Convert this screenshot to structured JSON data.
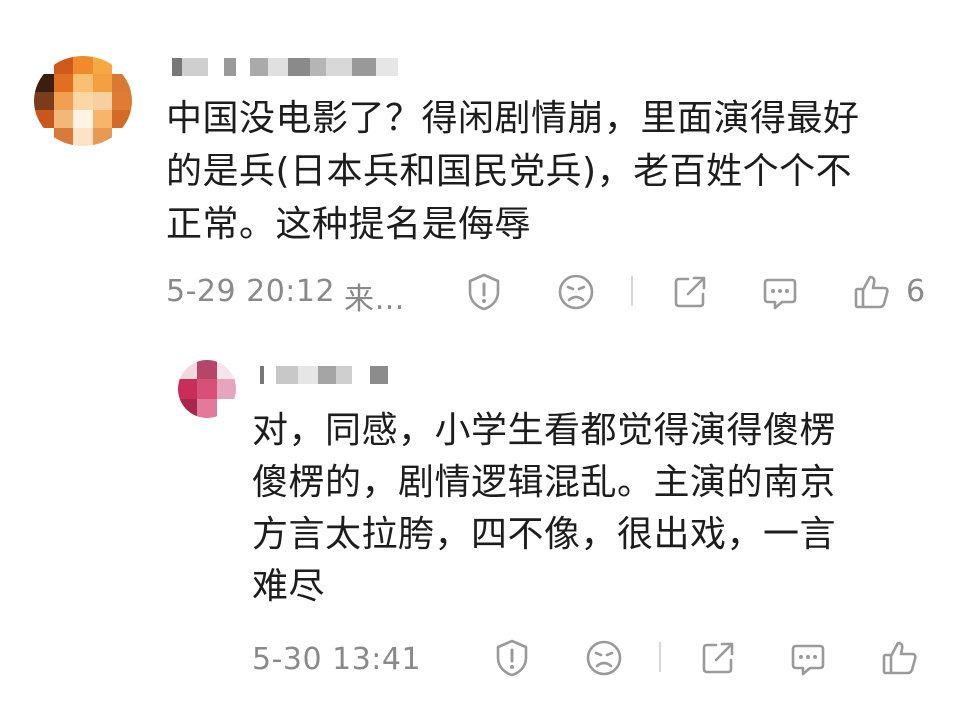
{
  "comments": [
    {
      "content": "中国没电影了？得闲剧情崩，里面演得最好的是兵(日本兵和国民党兵)，老百姓个个不正常。这种提名是侮辱",
      "lines": [
        "中国没电影了？得闲剧情崩，里面演得最好",
        "的是兵(日本兵和国民党兵)，老百姓个个不",
        "正常。这种提名是侮辱"
      ],
      "timestamp": "5-29 20:12",
      "source": "来…",
      "like_count": "6"
    },
    {
      "content": "对，同感，小学生看都觉得演得傻楞傻楞的，剧情逻辑混乱。主演的南京方言太拉胯，四不像，很出戏，一言难尽",
      "lines": [
        "对，同感，小学生看都觉得演得傻楞",
        "傻楞的，剧情逻辑混乱。主演的南京",
        "方言太拉胯，四不像，很出戏，一言",
        "难尽"
      ],
      "timestamp": "5-30 13:41",
      "source": "",
      "like_count": ""
    }
  ],
  "icons": {
    "report": "report-icon",
    "dislike": "dislike-face-icon",
    "share": "share-icon",
    "reply": "reply-icon",
    "like": "thumbs-up-icon"
  },
  "colors": {
    "text": "#1d1d1d",
    "meta": "#8a8a8a",
    "icon": "#9a9a9a"
  }
}
